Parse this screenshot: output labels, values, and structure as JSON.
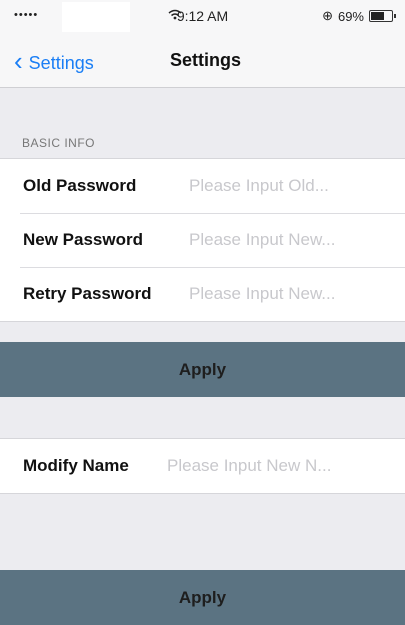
{
  "status_bar": {
    "signal": "•••••",
    "time": "9:12 AM",
    "battery_text": "69%",
    "battery_level": 0.69
  },
  "nav": {
    "back_label": "Settings",
    "title": "Settings"
  },
  "basic_info": {
    "header": "BASIC INFO",
    "old_password": {
      "label": "Old Password",
      "placeholder": "Please Input Old..."
    },
    "new_password": {
      "label": "New Password",
      "placeholder": "Please Input New..."
    },
    "retry_password": {
      "label": "Retry Password",
      "placeholder": "Please Input New..."
    }
  },
  "apply_password": {
    "label": "Apply"
  },
  "modify_name": {
    "label": "Modify Name",
    "placeholder": "Please Input New N..."
  },
  "apply_name": {
    "label": "Apply"
  },
  "colors": {
    "accent": "#1a7ef5",
    "apply_bg": "#5b7382",
    "background": "#ececf0"
  }
}
